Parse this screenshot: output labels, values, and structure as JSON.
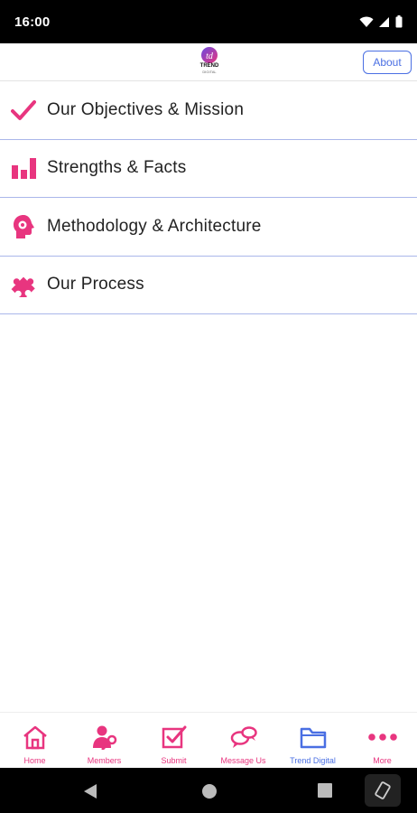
{
  "status_bar": {
    "time": "16:00"
  },
  "header": {
    "logo_text": "TREND",
    "logo_subtext": "DIGITAL",
    "about_label": "About"
  },
  "menu": {
    "items": [
      {
        "label": "Our Objectives & Mission",
        "icon": "checkmark-icon"
      },
      {
        "label": "Strengths & Facts",
        "icon": "bar-chart-icon"
      },
      {
        "label": "Methodology & Architecture",
        "icon": "head-gear-icon"
      },
      {
        "label": "Our Process",
        "icon": "puzzle-icon"
      }
    ]
  },
  "tabbar": {
    "tabs": [
      {
        "label": "Home",
        "icon": "home-icon",
        "color": "#e8357f"
      },
      {
        "label": "Members",
        "icon": "members-icon",
        "color": "#e8357f"
      },
      {
        "label": "Submit",
        "icon": "submit-checkbox-icon",
        "color": "#e8357f"
      },
      {
        "label": "Message Us",
        "icon": "chat-bubbles-icon",
        "color": "#e8357f"
      },
      {
        "label": "Trend Digital",
        "icon": "folder-icon",
        "color": "#4a6fe3"
      },
      {
        "label": "More",
        "icon": "more-dots-icon",
        "color": "#e8357f"
      }
    ]
  },
  "colors": {
    "accent_pink": "#e8357f",
    "accent_blue": "#4a6fe3",
    "divider": "#aab7ea"
  }
}
